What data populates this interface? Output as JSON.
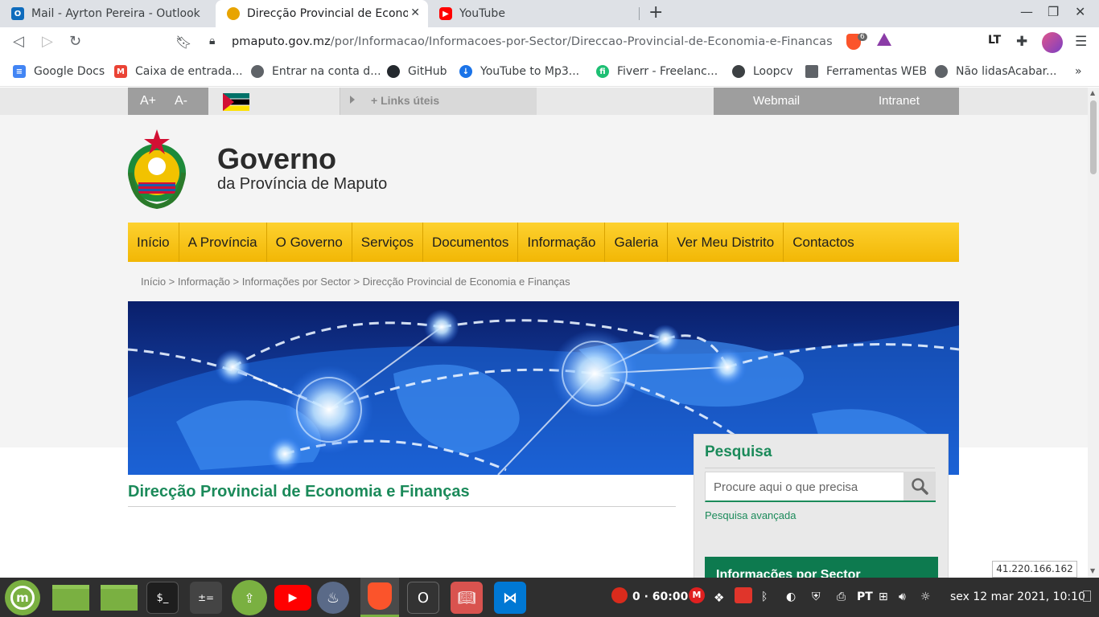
{
  "browser": {
    "tabs": [
      {
        "title": "Mail - Ayrton Pereira - Outlook",
        "icon": "outlook-icon",
        "color": "#0f6cbd"
      },
      {
        "title": "Direcção Provincial de Econom",
        "icon": "mozambique-emblem-icon",
        "color": "#e8a400"
      },
      {
        "title": "YouTube",
        "icon": "youtube-icon",
        "color": "#ff0000"
      }
    ],
    "url_host": "pmaputo.gov.mz",
    "url_path": "/por/Informacao/Informacoes-por-Sector/Direccao-Provincial-de-Economia-e-Financas",
    "brave_badge": "6",
    "bookmarks": [
      {
        "label": "Google Docs",
        "icon": "google-docs-icon",
        "color": "#4285f4"
      },
      {
        "label": "Caixa de entrada...",
        "icon": "gmail-icon",
        "color": "#ea4335"
      },
      {
        "label": "Entrar na conta d...",
        "icon": "globe-icon",
        "color": "#5f6368"
      },
      {
        "label": "GitHub",
        "icon": "github-icon",
        "color": "#24292e"
      },
      {
        "label": "YouTube to Mp3...",
        "icon": "download-cloud-icon",
        "color": "#1a73e8"
      },
      {
        "label": "Fiverr - Freelanc...",
        "icon": "fiverr-icon",
        "color": "#1dbf73"
      },
      {
        "label": "Loopcv",
        "icon": "loopcv-icon",
        "color": "#3c4043"
      },
      {
        "label": "Ferramentas WEB",
        "icon": "folder-icon",
        "color": "#5f6368"
      },
      {
        "label": "Não lidasAcabar...",
        "icon": "globe-icon",
        "color": "#5f6368"
      }
    ],
    "bookmarks_more": "»"
  },
  "site": {
    "font_plus": "A+",
    "font_minus": "A-",
    "links_label": "+ Links úteis",
    "webmail": "Webmail",
    "intranet": "Intranet",
    "title": "Governo",
    "subtitle": "da Província de Maputo",
    "nav": [
      "Início",
      "A Província",
      "O Governo",
      "Serviços",
      "Documentos",
      "Informação",
      "Galeria",
      "Ver Meu Distrito",
      "Contactos"
    ],
    "breadcrumb": "Início > Informação > Informações por Sector > Direcção Provincial de Economia e Finanças",
    "page_title": "Direcção Provincial de Economia e Finanças",
    "sidebar": {
      "search_title": "Pesquisa",
      "search_placeholder": "Procure aqui o que precisa",
      "advanced": "Pesquisa avançada",
      "sector_title": "Informações por Sector"
    },
    "accent_green": "#1b8a5a",
    "accent_yellow": "#f8c41a"
  },
  "ip_overlay": "41.220.166.162",
  "taskbar": {
    "timer": "0 · 60:00",
    "language": "PT",
    "clock": "sex 12 mar 2021, 10:10"
  }
}
